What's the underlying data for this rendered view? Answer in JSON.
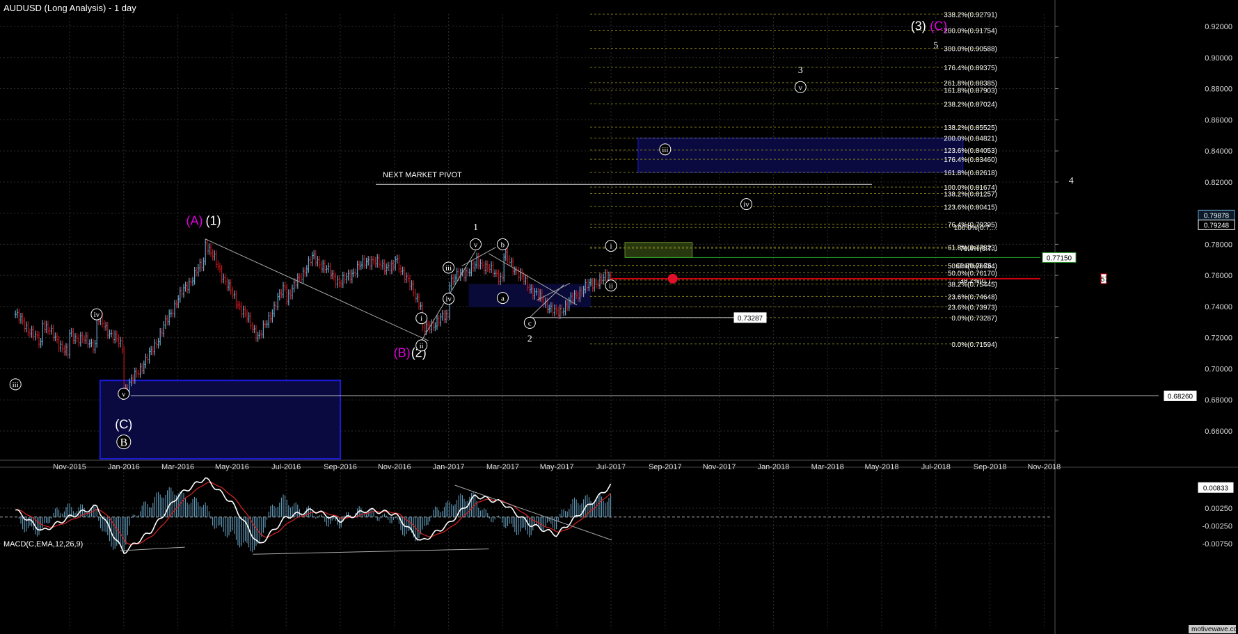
{
  "chart_title": "AUDUSD (Long Analysis) - 1 day",
  "colors": {
    "background": "#000000",
    "bull_bar": "#6aa6c8",
    "bear_bar": "#b8161c",
    "fib_line": "#7d7a1a",
    "magenta": "#e000e0",
    "blue_box_stroke": "#1a1ad8",
    "blue_box_fill": "#0a0a40",
    "green_box": "#6a8a2a",
    "green_line": "#2aa02a",
    "red_line": "#d00010",
    "macd_line": "#ffffff",
    "signal_line": "#cc2222",
    "histogram": "#6aa6c8"
  },
  "watermark": "motivewave.com",
  "chart_data": [
    {
      "type": "line",
      "title": "AUDUSD (Long Analysis) - 1 day",
      "x_ticks": [
        "Nov-2015",
        "Jan-2016",
        "Mar-2016",
        "May-2016",
        "Jul-2016",
        "Sep-2016",
        "Nov-2016",
        "Jan-2017",
        "Mar-2017",
        "May-2017",
        "Jul-2017",
        "Sep-2017",
        "Nov-2017",
        "Jan-2018",
        "Mar-2018",
        "May-2018",
        "Jul-2018",
        "Sep-2018",
        "Nov-2018"
      ],
      "y_ticks": [
        "0.92000",
        "0.90000",
        "0.88000",
        "0.86000",
        "0.84000",
        "0.82000",
        "0.80000",
        "0.78000",
        "0.76000",
        "0.74000",
        "0.72000",
        "0.70000",
        "0.68000",
        "0.66000"
      ],
      "ylim": [
        0.645,
        0.9335
      ],
      "price_path": [
        [
          "Sep-2015",
          0.735
        ],
        [
          "Oct-2015",
          0.715
        ],
        [
          "Oct-2015",
          0.695
        ],
        [
          "Oct-2015",
          0.73
        ],
        [
          "Nov-2015",
          0.708
        ],
        [
          "Nov-2015",
          0.722
        ],
        [
          "Dec-2015",
          0.715
        ],
        [
          "Dec-2015",
          0.733
        ],
        [
          "Jan-2016",
          0.713
        ],
        [
          "Jan-2016",
          0.685
        ],
        [
          "Feb-2016",
          0.71
        ],
        [
          "Mar-2016",
          0.745
        ],
        [
          "Apr-2016",
          0.77
        ],
        [
          "Apr-2016",
          0.782
        ],
        [
          "May-2016",
          0.748
        ],
        [
          "Jun-2016",
          0.72
        ],
        [
          "Jul-2016",
          0.755
        ],
        [
          "Jul-2016",
          0.745
        ],
        [
          "Aug-2016",
          0.772
        ],
        [
          "Sep-2016",
          0.755
        ],
        [
          "Oct-2016",
          0.77
        ],
        [
          "Nov-2016",
          0.764
        ],
        [
          "Nov-2016",
          0.772
        ],
        [
          "Dec-2016",
          0.74
        ],
        [
          "Dec-2016",
          0.724
        ],
        [
          "Jan-2017",
          0.735
        ],
        [
          "Jan-2017",
          0.756
        ],
        [
          "Feb-2017",
          0.766
        ],
        [
          "Feb-2017",
          0.77
        ],
        [
          "Mar-2017",
          0.758
        ],
        [
          "Mar-2017",
          0.774
        ],
        [
          "Apr-2017",
          0.752
        ],
        [
          "May-2017",
          0.735
        ],
        [
          "Jun-2017",
          0.752
        ],
        [
          "Jul-2017",
          0.76
        ],
        [
          "Jul-2017",
          0.775
        ],
        [
          "Jul-2017",
          0.7988
        ]
      ],
      "fib_levels_upper": [
        {
          "label": "338.2%(0.92791)",
          "value": 0.92791
        },
        {
          "label": "200.0%(0.91754)",
          "value": 0.91754
        },
        {
          "label": "300.0%(0.90588)",
          "value": 0.90588
        },
        {
          "label": "176.4%(0.89375)",
          "value": 0.89375
        },
        {
          "label": "261.8%(0.88385)",
          "value": 0.88385
        },
        {
          "label": "161.8%(0.87903)",
          "value": 0.87903
        },
        {
          "label": "238.2%(0.87024)",
          "value": 0.87024
        },
        {
          "label": "138.2%(0.85525)",
          "value": 0.85525
        },
        {
          "label": "200.0%(0.84821)",
          "value": 0.84821
        },
        {
          "label": "123.6%(0.84053)",
          "value": 0.84053
        },
        {
          "label": "176.4%(0.83460)",
          "value": 0.8346
        },
        {
          "label": "161.8%(0.82618)",
          "value": 0.82618
        },
        {
          "label": "100.0%(0.81674)",
          "value": 0.81674
        },
        {
          "label": "138.2%(0.81257)",
          "value": 0.81257
        },
        {
          "label": "123.6%(0.80415)",
          "value": 0.80415
        },
        {
          "label": "76.4%(0.79295)",
          "value": 0.79295
        },
        {
          "label": "100.0%(0.7....",
          "value": 0.7908
        },
        {
          "label": "76.4%(0.7...",
          "value": 0.7775
        },
        {
          "label": "61.8%(0.77823)",
          "value": 0.77823
        },
        {
          "label": "61.8%(0.76...",
          "value": 0.7665
        },
        {
          "label": "50.0%(0.76634)",
          "value": 0.76634
        },
        {
          "label": "50.0%(0.76170)",
          "value": 0.7617
        },
        {
          "label": "38.2%(0.7...",
          "value": 0.757
        },
        {
          "label": "38.2%(0.75445)",
          "value": 0.75445
        },
        {
          "label": "23.6%(0.74648)",
          "value": 0.74648
        },
        {
          "label": "23.6%(0.73973)",
          "value": 0.73973
        },
        {
          "label": "0.0%(0.73287)",
          "value": 0.73287
        },
        {
          "label": "0.0%(0.71594)",
          "value": 0.71594
        }
      ],
      "price_tags": [
        {
          "label": "0.79878",
          "value": 0.79878,
          "style": "current"
        },
        {
          "label": "0.79248",
          "value": 0.79248,
          "style": "dark"
        },
        {
          "label": "0.77150",
          "value": 0.7715,
          "style": "green"
        },
        {
          "label": "0.75790",
          "value": 0.7579,
          "style": "red"
        },
        {
          "label": "0.73287",
          "value": 0.73287,
          "style": "plain"
        },
        {
          "label": "0.68260",
          "value": 0.6826,
          "style": "plain"
        }
      ],
      "annotations": {
        "next_market_pivot": "NEXT MARKET PIVOT",
        "wave_labels": [
          {
            "text": "(A)",
            "color": "magenta",
            "date": "Apr-2016",
            "price": 0.7925
          },
          {
            "text": "(1)",
            "color": "white",
            "date": "Apr-2016",
            "price": 0.7925
          },
          {
            "text": "(B)",
            "color": "magenta",
            "date": "Dec-2016",
            "price": 0.7075
          },
          {
            "text": "(2)",
            "color": "white",
            "date": "Dec-2016",
            "price": 0.7075
          },
          {
            "text": "(3)",
            "color": "white",
            "date": "Jul-2018",
            "price": 0.9175
          },
          {
            "text": "(C)",
            "color": "magenta",
            "date": "Jul-2018",
            "price": 0.9175
          },
          {
            "text": "5",
            "color": "white",
            "date": "Jul-2018",
            "price": 0.906
          },
          {
            "text": "3",
            "color": "white",
            "date": "Feb-2018",
            "price": 0.89
          },
          {
            "text": "4",
            "color": "white",
            "date": "Dec-2018",
            "price": 0.819
          },
          {
            "text": "1",
            "color": "white",
            "date": "Feb-2017",
            "price": 0.789
          },
          {
            "text": "2",
            "color": "white",
            "date": "Apr-2017",
            "price": 0.7175
          },
          {
            "text": "5",
            "color": "white",
            "date": "Jan-2016",
            "price": 0.68
          },
          {
            "text": "(C)",
            "color": "white",
            "date": "Jan-2016",
            "price": 0.6615
          }
        ],
        "circled_labels": [
          {
            "text": "iii",
            "date": "Sep-2015",
            "price": 0.69
          },
          {
            "text": "iv",
            "date": "Dec-2015",
            "price": 0.735
          },
          {
            "text": "v",
            "date": "Jan-2016",
            "price": 0.684
          },
          {
            "text": "B",
            "date": "Jan-2016",
            "price": 0.653
          },
          {
            "text": "i",
            "date": "Dec-2016",
            "price": 0.7325
          },
          {
            "text": "ii",
            "date": "Dec-2016",
            "price": 0.715
          },
          {
            "text": "iii",
            "date": "Jan-2017",
            "price": 0.765
          },
          {
            "text": "iv",
            "date": "Jan-2017",
            "price": 0.745
          },
          {
            "text": "v",
            "date": "Feb-2017",
            "price": 0.78
          },
          {
            "text": "b",
            "date": "Mar-2017",
            "price": 0.78
          },
          {
            "text": "a",
            "date": "Mar-2017",
            "price": 0.7455
          },
          {
            "text": "c",
            "date": "Apr-2017",
            "price": 0.7295
          },
          {
            "text": "i",
            "date": "Jul-2017",
            "price": 0.779
          },
          {
            "text": "ii",
            "date": "Jul-2017",
            "price": 0.7535
          },
          {
            "text": "iii",
            "date": "Sep-2017",
            "price": 0.841
          },
          {
            "text": "iv",
            "date": "Dec-2017",
            "price": 0.8058
          },
          {
            "text": "v",
            "date": "Feb-2018",
            "price": 0.881
          }
        ]
      }
    },
    {
      "type": "line",
      "title": "MACD(C,EMA,12,26,9)",
      "y_ticks": [
        "0.00250",
        "-0.00250",
        "-0.00750"
      ],
      "current_value_label": "0.00833",
      "ylim": [
        -0.0115,
        0.0115
      ],
      "macd_path": [
        [
          "Sep-2015",
          0.002
        ],
        [
          "Oct-2015",
          -0.004
        ],
        [
          "Nov-2015",
          0.0
        ],
        [
          "Dec-2015",
          0.003
        ],
        [
          "Jan-2016",
          -0.01
        ],
        [
          "Feb-2016",
          -0.004
        ],
        [
          "Mar-2016",
          0.006
        ],
        [
          "Apr-2016",
          0.011
        ],
        [
          "May-2016",
          0.004
        ],
        [
          "Jun-2016",
          -0.008
        ],
        [
          "Jul-2016",
          0.0
        ],
        [
          "Aug-2016",
          0.002
        ],
        [
          "Sep-2016",
          -0.001
        ],
        [
          "Oct-2016",
          0.002
        ],
        [
          "Nov-2016",
          0.001
        ],
        [
          "Dec-2016",
          -0.007
        ],
        [
          "Jan-2017",
          -0.002
        ],
        [
          "Feb-2017",
          0.006
        ],
        [
          "Mar-2017",
          0.004
        ],
        [
          "Apr-2017",
          -0.002
        ],
        [
          "May-2017",
          -0.005
        ],
        [
          "Jun-2017",
          0.002
        ],
        [
          "Jul-2017",
          0.009
        ]
      ]
    }
  ]
}
